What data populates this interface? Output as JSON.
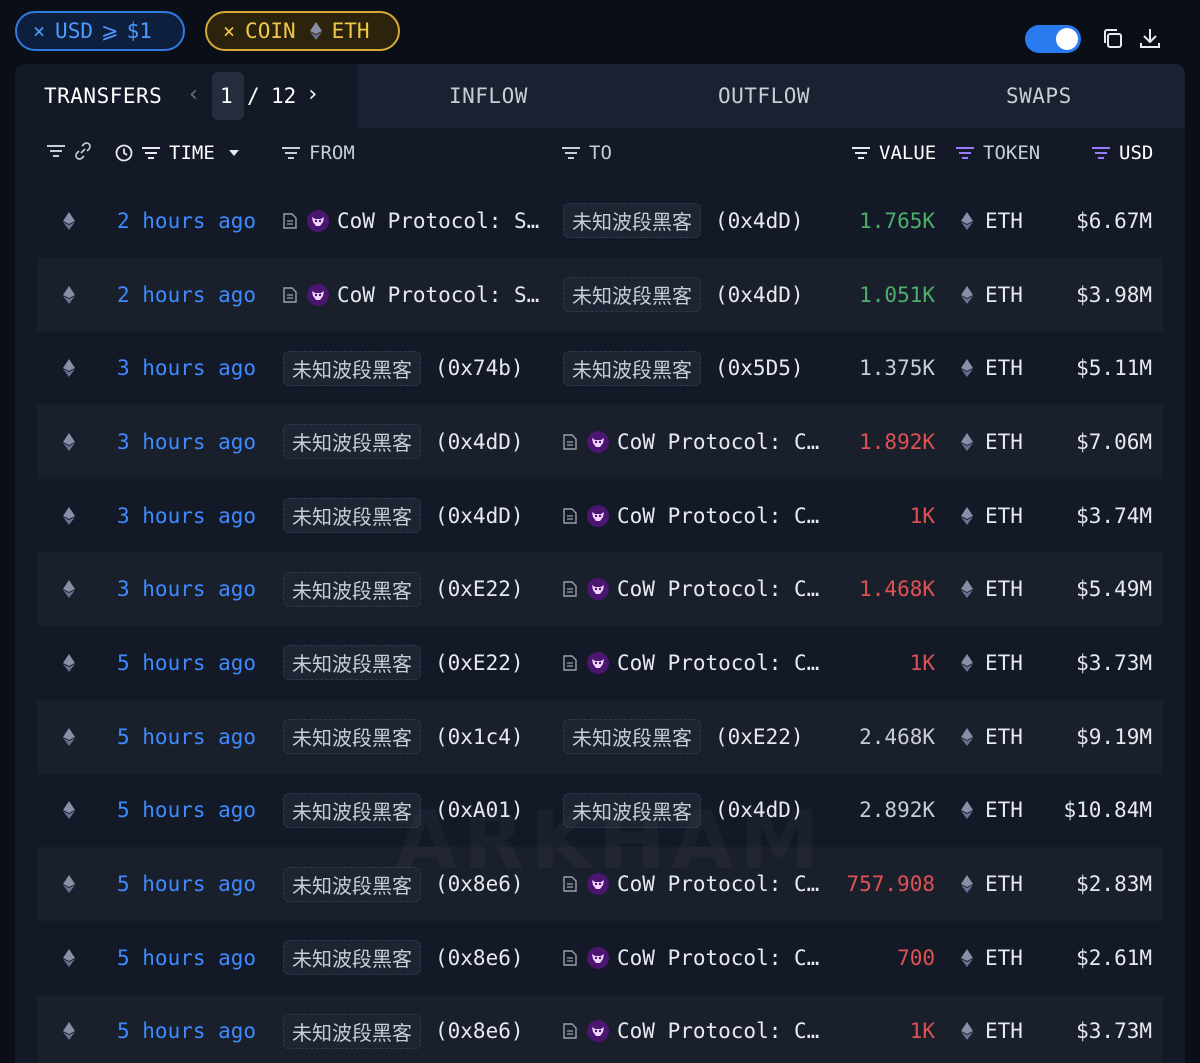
{
  "filters": {
    "usd_chip": {
      "close": "×",
      "label": "USD",
      "op": "⩾",
      "value": "$1"
    },
    "coin_chip": {
      "close": "×",
      "label": "COIN",
      "token": "ETH"
    }
  },
  "tabs": {
    "title": "TRANSFERS",
    "page_current": "1",
    "page_sep": "/",
    "page_total": "12",
    "inflow": "INFLOW",
    "outflow": "OUTFLOW",
    "swaps": "SWAPS"
  },
  "columns": {
    "time": "TIME",
    "from": "FROM",
    "to": "TO",
    "value": "VALUE",
    "token": "TOKEN",
    "usd": "USD"
  },
  "watermark": "ARKHAM",
  "rows": [
    {
      "time": "2 hours ago",
      "from_type": "cow",
      "from_name": "CoW Protocol: S…",
      "from_addr": "",
      "to_type": "tag",
      "to_name": "未知波段黑客",
      "to_addr": "(0x4dD)",
      "value": "1.765K",
      "value_kind": "pos",
      "token": "ETH",
      "usd": "$6.67M"
    },
    {
      "time": "2 hours ago",
      "from_type": "cow",
      "from_name": "CoW Protocol: S…",
      "from_addr": "",
      "to_type": "tag",
      "to_name": "未知波段黑客",
      "to_addr": "(0x4dD)",
      "value": "1.051K",
      "value_kind": "pos",
      "token": "ETH",
      "usd": "$3.98M"
    },
    {
      "time": "3 hours ago",
      "from_type": "tag",
      "from_name": "未知波段黑客",
      "from_addr": "(0x74b)",
      "to_type": "tag",
      "to_name": "未知波段黑客",
      "to_addr": "(0x5D5)",
      "value": "1.375K",
      "value_kind": "neu",
      "token": "ETH",
      "usd": "$5.11M"
    },
    {
      "time": "3 hours ago",
      "from_type": "tag",
      "from_name": "未知波段黑客",
      "from_addr": "(0x4dD)",
      "to_type": "cow",
      "to_name": "CoW Protocol: C…",
      "to_addr": "",
      "value": "1.892K",
      "value_kind": "neg",
      "token": "ETH",
      "usd": "$7.06M"
    },
    {
      "time": "3 hours ago",
      "from_type": "tag",
      "from_name": "未知波段黑客",
      "from_addr": "(0x4dD)",
      "to_type": "cow",
      "to_name": "CoW Protocol: C…",
      "to_addr": "",
      "value": "1K",
      "value_kind": "neg",
      "token": "ETH",
      "usd": "$3.74M"
    },
    {
      "time": "3 hours ago",
      "from_type": "tag",
      "from_name": "未知波段黑客",
      "from_addr": "(0xE22)",
      "to_type": "cow",
      "to_name": "CoW Protocol: C…",
      "to_addr": "",
      "value": "1.468K",
      "value_kind": "neg",
      "token": "ETH",
      "usd": "$5.49M"
    },
    {
      "time": "5 hours ago",
      "from_type": "tag",
      "from_name": "未知波段黑客",
      "from_addr": "(0xE22)",
      "to_type": "cow",
      "to_name": "CoW Protocol: C…",
      "to_addr": "",
      "value": "1K",
      "value_kind": "neg",
      "token": "ETH",
      "usd": "$3.73M"
    },
    {
      "time": "5 hours ago",
      "from_type": "tag",
      "from_name": "未知波段黑客",
      "from_addr": "(0x1c4)",
      "to_type": "tag",
      "to_name": "未知波段黑客",
      "to_addr": "(0xE22)",
      "value": "2.468K",
      "value_kind": "neu",
      "token": "ETH",
      "usd": "$9.19M"
    },
    {
      "time": "5 hours ago",
      "from_type": "tag",
      "from_name": "未知波段黑客",
      "from_addr": "(0xA01)",
      "to_type": "tag",
      "to_name": "未知波段黑客",
      "to_addr": "(0x4dD)",
      "value": "2.892K",
      "value_kind": "neu",
      "token": "ETH",
      "usd": "$10.84M"
    },
    {
      "time": "5 hours ago",
      "from_type": "tag",
      "from_name": "未知波段黑客",
      "from_addr": "(0x8e6)",
      "to_type": "cow",
      "to_name": "CoW Protocol: C…",
      "to_addr": "",
      "value": "757.908",
      "value_kind": "neg",
      "token": "ETH",
      "usd": "$2.83M"
    },
    {
      "time": "5 hours ago",
      "from_type": "tag",
      "from_name": "未知波段黑客",
      "from_addr": "(0x8e6)",
      "to_type": "cow",
      "to_name": "CoW Protocol: C…",
      "to_addr": "",
      "value": "700",
      "value_kind": "neg",
      "token": "ETH",
      "usd": "$2.61M"
    },
    {
      "time": "5 hours ago",
      "from_type": "tag",
      "from_name": "未知波段黑客",
      "from_addr": "(0x8e6)",
      "to_type": "cow",
      "to_name": "CoW Protocol: C…",
      "to_addr": "",
      "value": "1K",
      "value_kind": "neg",
      "token": "ETH",
      "usd": "$3.73M"
    }
  ]
}
